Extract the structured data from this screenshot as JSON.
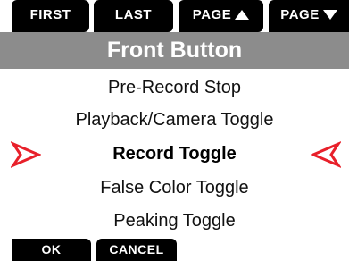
{
  "softkeys_top": {
    "first": "FIRST",
    "last": "LAST",
    "page_up": "PAGE",
    "page_down": "PAGE"
  },
  "title": "Front Button",
  "menu": {
    "items": [
      {
        "label": "Pre-Record Stop",
        "selected": false
      },
      {
        "label": "Playback/Camera Toggle",
        "selected": false
      },
      {
        "label": "Record Toggle",
        "selected": true
      },
      {
        "label": "False Color Toggle",
        "selected": false
      },
      {
        "label": "Peaking Toggle",
        "selected": false
      }
    ]
  },
  "softkeys_bottom": {
    "ok": "OK",
    "cancel": "CANCEL"
  },
  "colors": {
    "softkey_bg": "#000000",
    "softkey_text": "#ffffff",
    "title_bg": "#8c8c8c",
    "title_text": "#ffffff",
    "selection_arrow": "#e8202a",
    "background": "#ffffff"
  },
  "icons": {
    "page_up": "triangle-up-icon",
    "page_down": "triangle-down-icon",
    "selector_left": "chevron-right-outline-icon",
    "selector_right": "chevron-left-outline-icon"
  }
}
